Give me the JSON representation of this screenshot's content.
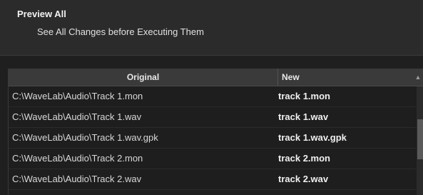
{
  "dialog": {
    "title": "Preview All",
    "subtitle": "See All Changes before Executing Them"
  },
  "table": {
    "columns": [
      "Original",
      "New"
    ],
    "rows": [
      {
        "original": "C:\\WaveLab\\Audio\\Track 1.mon",
        "new": "track 1.mon"
      },
      {
        "original": "C:\\WaveLab\\Audio\\Track 1.wav",
        "new": "track 1.wav"
      },
      {
        "original": "C:\\WaveLab\\Audio\\Track 1.wav.gpk",
        "new": "track 1.wav.gpk"
      },
      {
        "original": "C:\\WaveLab\\Audio\\Track 2.mon",
        "new": "track 2.mon"
      },
      {
        "original": "C:\\WaveLab\\Audio\\Track 2.wav",
        "new": "track 2.wav"
      }
    ]
  },
  "icons": {
    "sort": "sort-indicator-icon"
  }
}
